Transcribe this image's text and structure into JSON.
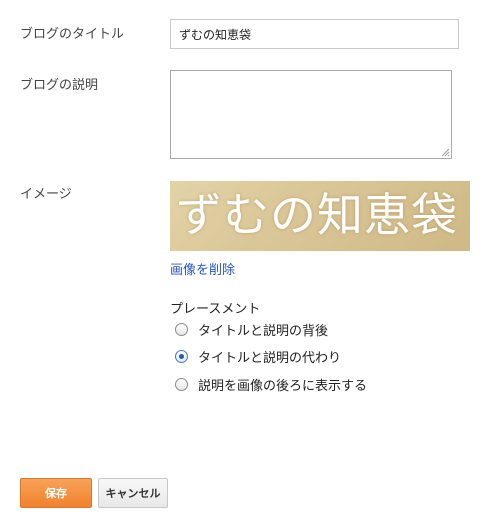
{
  "form": {
    "blog_title_label": "ブログのタイトル",
    "blog_title_value": "ずむの知恵袋",
    "blog_description_label": "ブログの説明",
    "blog_description_value": "",
    "image_label": "イメージ",
    "banner_text": "ずむの知恵袋",
    "remove_image_link": "画像を削除",
    "placement_label": "プレースメント",
    "placement_options": [
      {
        "label": "タイトルと説明の背後",
        "selected": false
      },
      {
        "label": "タイトルと説明の代わり",
        "selected": true
      },
      {
        "label": "説明を画像の後ろに表示する",
        "selected": false
      }
    ]
  },
  "buttons": {
    "save_label": "保存",
    "cancel_label": "キャンセル"
  },
  "colors": {
    "accent_orange": "#f0822d",
    "link_blue": "#2554c7",
    "banner_tan": "#d9c596"
  }
}
